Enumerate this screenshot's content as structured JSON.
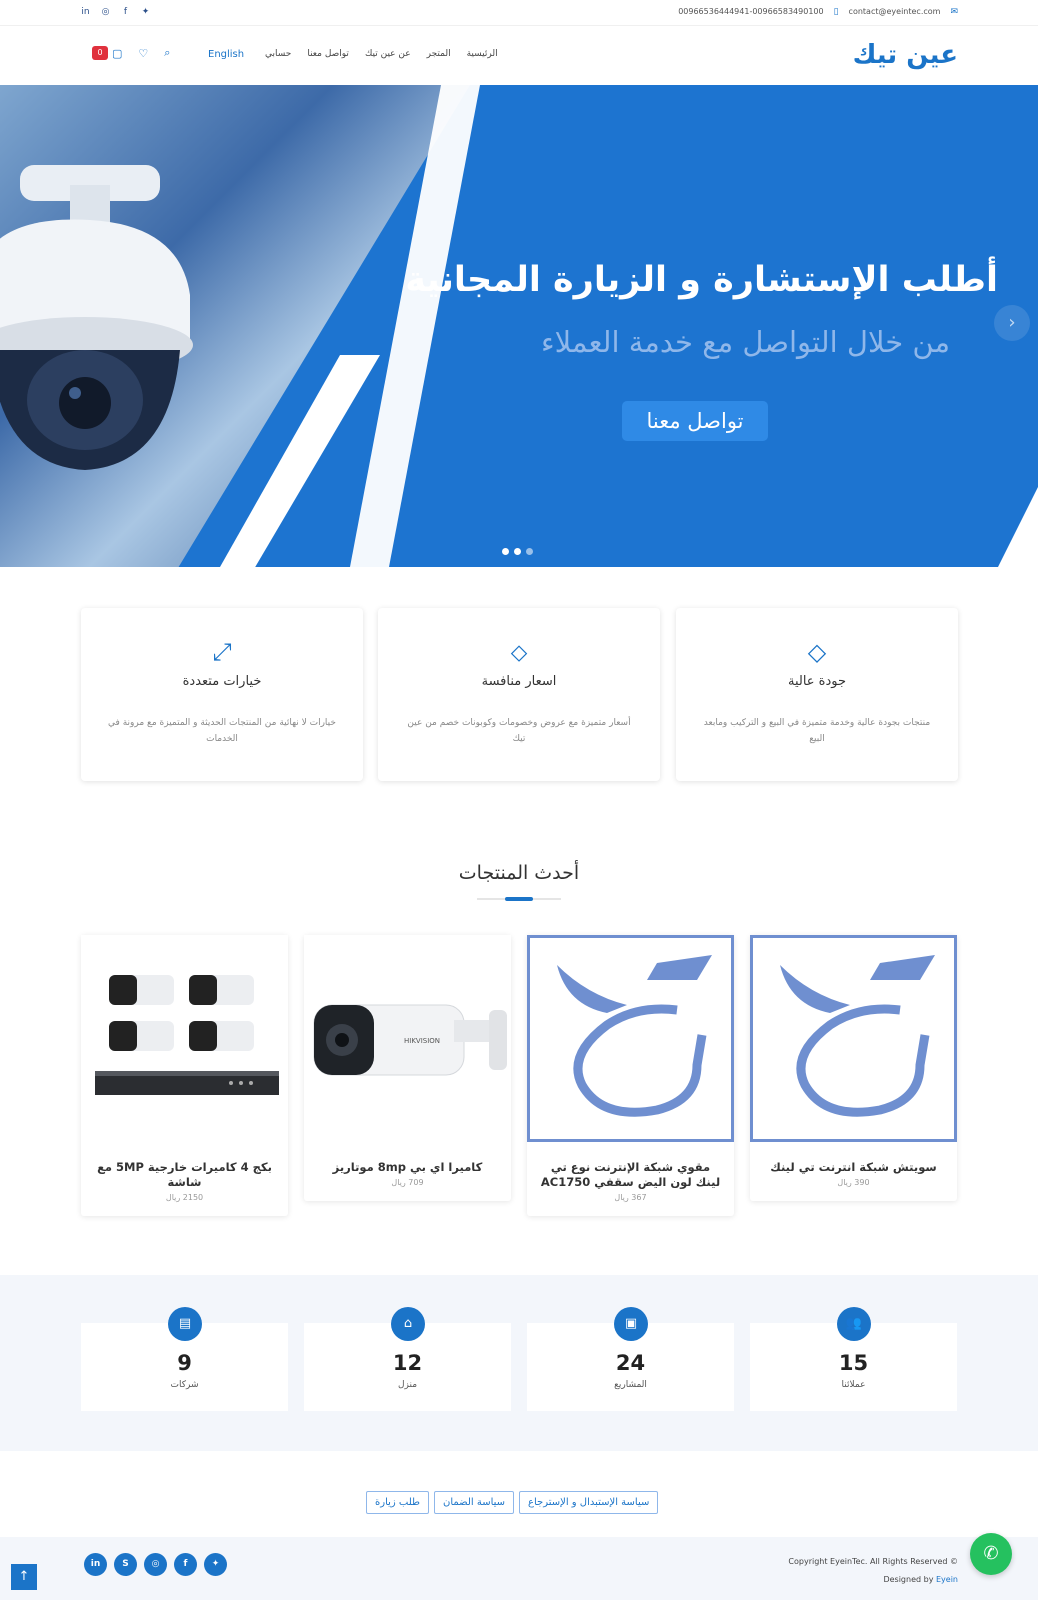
{
  "topbar": {
    "phones": "00966536444941-00966583490100",
    "email": "contact@eyeintec.com",
    "social_icons": [
      "linkedin-icon",
      "instagram-icon",
      "facebook-icon",
      "twitter-icon"
    ]
  },
  "nav": {
    "logo": "عين تيك",
    "items": [
      "الرئيسية",
      "المتجر",
      "عن عين تيك",
      "تواصل معنا",
      "حسابي"
    ],
    "language": "English",
    "cart_count": "0"
  },
  "hero": {
    "title": "أطلب الإستشارة و الزيارة المجانية",
    "subtitle": "من خلال التواصل مع خدمة العملاء",
    "cta": "تواصل معنا"
  },
  "features": [
    {
      "icon": "diamond-icon",
      "title": "جودة عالية",
      "desc": "منتجات بجودة عالية وخدمة متميزة في البيع و التركيب ومابعد البيع"
    },
    {
      "icon": "tag-icon",
      "title": "اسعار منافسة",
      "desc": "أسعار متميزة مع عروض وخصومات وكوبونات خصم من عين تيك"
    },
    {
      "icon": "expand-icon",
      "title": "خيارات متعددة",
      "desc": "خيارات لا نهائية من المنتجات الحديثة و المتميزة مع مرونة في الخدمات"
    }
  ],
  "latest": {
    "title": "أحدث المنتجات",
    "products": [
      {
        "name": "سويتش شبكة انترنت تي لينك",
        "price": "390 ريال"
      },
      {
        "name": "مقوي شبكة الإنترنت نوع تي لينك لون اليض سقفي AC1750",
        "price": "367 ريال"
      },
      {
        "name": "كاميرا اي بي 8mp موتاريز",
        "price": "709 ريال"
      },
      {
        "name": "بكج 4 كاميرات خارجية 5MP مع شاشة",
        "price": "2150 ريال"
      }
    ]
  },
  "counters": [
    {
      "icon": "users-icon",
      "value": "15",
      "label": "عملائنا"
    },
    {
      "icon": "video-icon",
      "value": "24",
      "label": "المشاريع"
    },
    {
      "icon": "home-icon",
      "value": "12",
      "label": "منزل"
    },
    {
      "icon": "building-icon",
      "value": "9",
      "label": "شركات"
    }
  ],
  "policies": [
    "سياسة الإستبدال و الإسترجاع",
    "سياسة الضمان",
    "طلب زيارة"
  ],
  "footer": {
    "copyright": "Copyright EyeinTec. All Rights Reserved ©",
    "designed_by": "Designed by",
    "designer": "Eyein",
    "social": [
      "twitter-icon",
      "facebook-icon",
      "instagram-icon",
      "skype-icon",
      "linkedin-icon"
    ]
  },
  "colors": {
    "primary": "#1b74c8",
    "hero": "#1d74d0",
    "badge": "#e0313d",
    "whatsapp": "#25c15f"
  }
}
